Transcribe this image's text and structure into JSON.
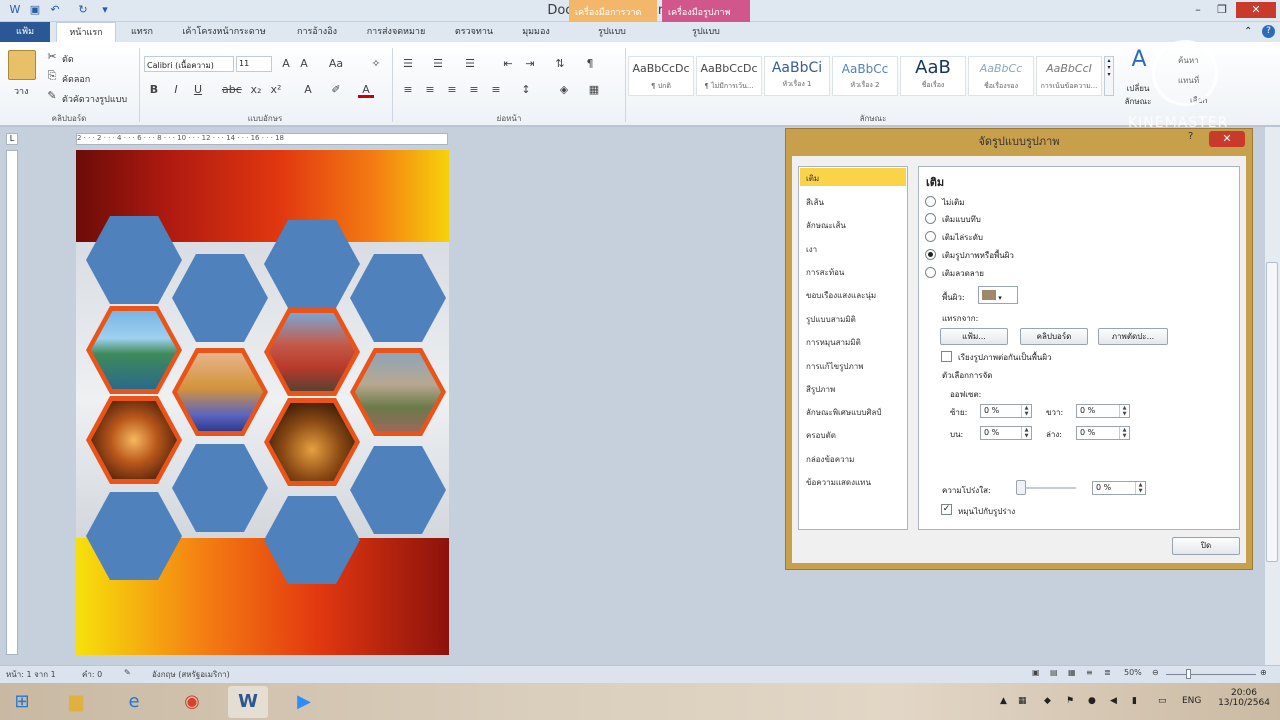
{
  "window": {
    "title": "Document1 - Microsoft Word",
    "context_tab_1": "เครื่องมือการวาด",
    "context_tab_2": "เครื่องมือรูปภาพ",
    "minimize": "–",
    "maximize": "❐",
    "close": "✕"
  },
  "tabs": {
    "file": "แฟ้ม",
    "items": [
      "หน้าแรก",
      "แทรก",
      "เค้าโครงหน้ากระดาษ",
      "การอ้างอิง",
      "การส่งจดหมาย",
      "ตรวจทาน",
      "มุมมอง",
      "รูปแบบ",
      "รูปแบบ"
    ]
  },
  "ribbon": {
    "clipboard": {
      "paste": "วาง",
      "cut": "ตัด",
      "copy": "คัดลอก",
      "format_painter": "ตัวคัดวางรูปแบบ",
      "label": "คลิปบอร์ด"
    },
    "font": {
      "name": "Calibri (เนื้อความ)",
      "size": "11",
      "label": "แบบอักษร"
    },
    "paragraph": {
      "label": "ย่อหน้า"
    },
    "styles": {
      "label": "ลักษณะ",
      "items": [
        {
          "sample": "AaBbCcDc",
          "name": "¶ ปกติ"
        },
        {
          "sample": "AaBbCcDc",
          "name": "¶ ไม่มีการเว้น..."
        },
        {
          "sample": "AaBbCi",
          "name": "หัวเรื่อง 1"
        },
        {
          "sample": "AaBbCc",
          "name": "หัวเรื่อง 2"
        },
        {
          "sample": "AaB",
          "name": "ชื่อเรื่อง"
        },
        {
          "sample": "AaBbCc",
          "name": "ชื่อเรื่องรอง"
        },
        {
          "sample": "AaBbCcI",
          "name": "การเน้นข้อความ..."
        }
      ],
      "change_styles": "เปลี่ยนลักษณะ",
      "find": "ค้นหา",
      "replace": "แทนที่",
      "select": "เลือก"
    }
  },
  "ruler": {
    "marks": "2 · · · 2 · · · 4 · · · 6 · · · 8 · · · 10 · · · 12 · · · 14 · · · 16 · · · 18"
  },
  "dialog": {
    "title": "จัดรูปแบบรูปภาพ",
    "help": "?",
    "close": "✕",
    "categories": [
      "เติม",
      "สีเส้น",
      "ลักษณะเส้น",
      "เงา",
      "การสะท้อน",
      "ขอบเรืองแสงและนุ่ม",
      "รูปแบบสามมิติ",
      "การหมุนสามมิติ",
      "การแก้ไขรูปภาพ",
      "สีรูปภาพ",
      "ลักษณะพิเศษแบบศิลป์",
      "ครอบตัด",
      "กล่องข้อความ",
      "ข้อความแสดงแทน"
    ],
    "selected_category": "เติม",
    "panel_title": "เติม",
    "fill_options": [
      "ไม่เติม",
      "เติมแบบทึบ",
      "เติมไล่ระดับ",
      "เติมรูปภาพหรือพื้นผิว",
      "เติมลวดลาย"
    ],
    "selected_fill": "เติมรูปภาพหรือพื้นผิว",
    "texture_label": "พื้นผิว:",
    "insert_from": "แทรกจาก:",
    "btn_file": "แฟ้ม...",
    "btn_clipboard": "คลิปบอร์ด",
    "btn_clipart": "ภาพตัดปะ...",
    "tile_checkbox": "เรียงรูปภาพต่อกันเป็นพื้นผิว",
    "tiling_options": "ตัวเลือกการจัด",
    "offsets": "ออฟเซต:",
    "left_label": "ซ้าย:",
    "left_val": "0 %",
    "right_label": "ขวา:",
    "right_val": "0 %",
    "top_label": "บน:",
    "top_val": "0 %",
    "bottom_label": "ล่าง:",
    "bottom_val": "0 %",
    "transparency_label": "ความโปร่งใส:",
    "transparency_val": "0 %",
    "rotate_checkbox": "หมุนไปกับรูปร่าง",
    "close_button": "ปิด"
  },
  "statusbar": {
    "page": "หน้า: 1 จาก 1",
    "words": "คำ: 0",
    "language": "อังกฤษ (สหรัฐอเมริกา)",
    "zoom": "50%"
  },
  "taskbar": {
    "time": "20:06",
    "date": "13/10/2564",
    "lang": "ENG"
  },
  "watermark": "KINEMASTER",
  "colors": {
    "file_tab": "#2b5797",
    "hex_blue": "#4f81bd",
    "hex_border": "#e9541a",
    "dialog_frame": "#c8a04c",
    "selected_cat": "#fbd349"
  }
}
